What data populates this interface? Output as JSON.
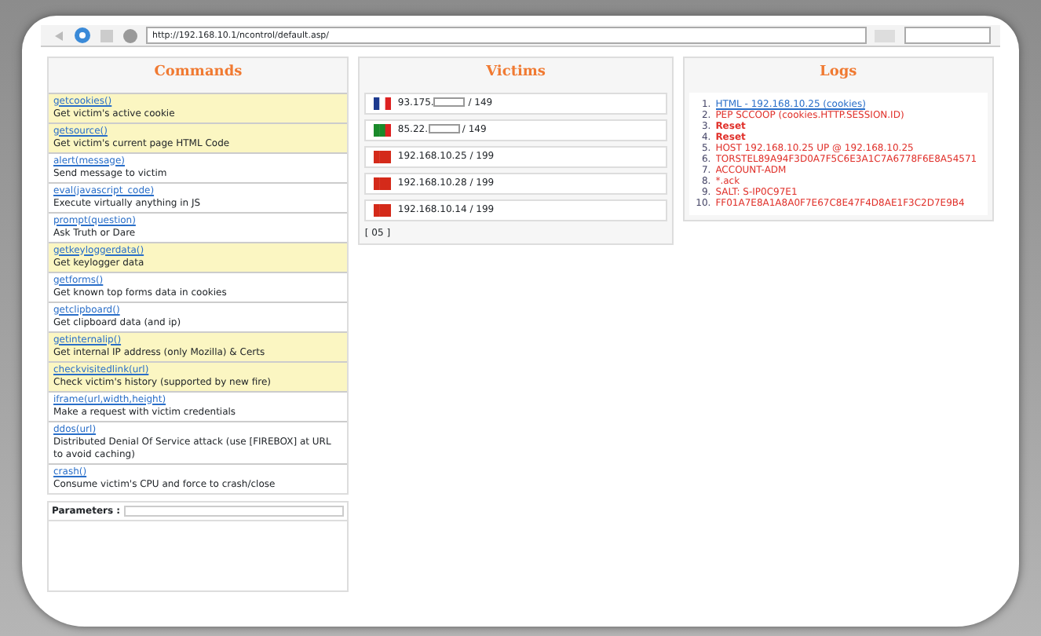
{
  "browser": {
    "address": "http://192.168.10.1/ncontrol/default.asp/"
  },
  "commands": {
    "title": "Commands",
    "items": [
      {
        "name": "getcookies()",
        "description": "Get victim's active cookie",
        "highlighted": true
      },
      {
        "name": "getsource()",
        "description": "Get victim's current page HTML Code",
        "highlighted": true
      },
      {
        "name": "alert(message)",
        "description": "Send message to victim",
        "highlighted": false
      },
      {
        "name": "eval(javascript_code)",
        "description": "Execute virtually anything in JS",
        "highlighted": false
      },
      {
        "name": "prompt(question)",
        "description": "Ask Truth or Dare",
        "highlighted": false
      },
      {
        "name": "getkeyloggerdata()",
        "description": "Get keylogger data",
        "highlighted": true
      },
      {
        "name": "getforms()",
        "description": "Get known top forms data in cookies",
        "highlighted": false
      },
      {
        "name": "getclipboard()",
        "description": "Get clipboard data (and ip)",
        "highlighted": false
      },
      {
        "name": "getinternalip()",
        "description": "Get internal IP address (only Mozilla) & Certs",
        "highlighted": true
      },
      {
        "name": "checkvisitedlink(url)",
        "description": "Check victim's history (supported by new fire)",
        "highlighted": true
      },
      {
        "name": "iframe(url,width,height)",
        "description": "Make a request with victim credentials",
        "highlighted": false
      },
      {
        "name": "ddos(url)",
        "description": "Distributed Denial Of Service attack (use [FIREBOX] at URL to avoid caching)",
        "highlighted": false
      },
      {
        "name": "crash()",
        "description": "Consume victim's CPU and force to crash/close",
        "highlighted": false
      }
    ],
    "parameters_label": "Parameters :"
  },
  "victims": {
    "title": "Victims",
    "items": [
      {
        "kind": "fr",
        "ip_start": "93.175.",
        "redacted": true,
        "ip_end": " / 149"
      },
      {
        "kind": "pt",
        "ip_start": "85.22.",
        "redacted": true,
        "ip_end": " / 149"
      },
      {
        "kind": "cn",
        "ip_start": "192.168.10.25 / 199",
        "redacted": false
      },
      {
        "kind": "cn",
        "ip_start": "192.168.10.28 / 199",
        "redacted": false
      },
      {
        "kind": "cn",
        "ip_start": "192.168.10.14 / 199",
        "redacted": false
      }
    ],
    "footer": "[ 05 ]"
  },
  "logs": {
    "title": "Logs",
    "items": [
      {
        "number": "1.",
        "text": "HTML - 192.168.10.25 (cookies)",
        "kind": "link"
      },
      {
        "number": "2.",
        "text": "PEP SCCOOP (cookies.HTTP.SESSION.ID)",
        "kind": "error"
      },
      {
        "number": "3.",
        "text": "Reset",
        "kind": "bold"
      },
      {
        "number": "4.",
        "text": "Reset",
        "kind": "bold"
      },
      {
        "number": "5.",
        "text": "HOST 192.168.10.25 UP @ 192.168.10.25",
        "kind": "error"
      },
      {
        "number": "6.",
        "text": "TORSTEL89A94F3D0A7F5C6E3A1C7A6778F6E8A54571",
        "kind": "error"
      },
      {
        "number": "7.",
        "text": "ACCOUNT-ADM",
        "kind": "error"
      },
      {
        "number": "8.",
        "text": "*.ack",
        "kind": "error"
      },
      {
        "number": "9.",
        "text": "SALT: S-IP0C97E1",
        "kind": "error"
      },
      {
        "number": "10.",
        "text": "FF01A7E8A1A8A0F7E67C8E47F4D8AE1F3C2D7E9B4",
        "kind": "error"
      }
    ]
  }
}
